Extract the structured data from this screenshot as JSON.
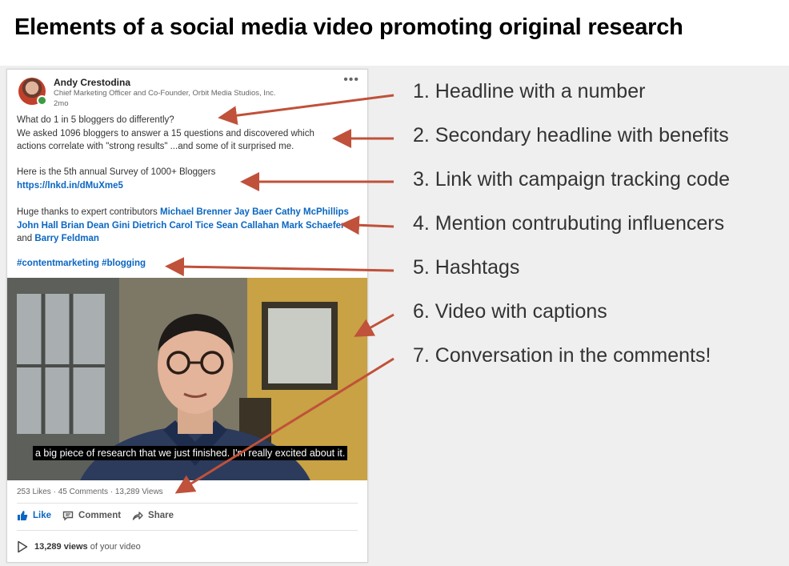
{
  "title": "Elements of a social media video promoting original research",
  "post": {
    "author_name": "Andy Crestodina",
    "author_title": "Chief Marketing Officer and Co-Founder, Orbit Media Studios, Inc.",
    "time": "2mo",
    "more": "•••",
    "line1": "What do 1 in 5 bloggers do differently?",
    "line2a": "We asked 1096 bloggers to answer a 15 questions and discovered which",
    "line2b": "actions correlate with \"strong results\" ...and some of it surprised me.",
    "line3": "Here is the 5th annual Survey of 1000+ Bloggers",
    "link": "https://lnkd.in/dMuXme5",
    "thanks_prefix": "Huge thanks to expert contributors ",
    "contributors": [
      "Michael Brenner",
      "Jay Baer",
      "Cathy McPhillips",
      "John Hall",
      "Brian Dean",
      "Gini Dietrich",
      "Carol Tice",
      "Sean Callahan",
      "Mark Schaefer"
    ],
    "and": " and ",
    "last_contributor": "Barry Feldman",
    "hashtags": "#contentmarketing #blogging",
    "caption": "a big piece of research that we just finished. I'm really excited about it.",
    "stats": "253 Likes · 45 Comments · 13,289 Views",
    "actions": {
      "like": "Like",
      "comment": "Comment",
      "share": "Share"
    },
    "views_count": "13,289 views",
    "views_suffix": " of your video"
  },
  "list": [
    "1. Headline with a number",
    "2. Secondary headline with benefits",
    "3. Link with campaign tracking code",
    "4. Mention contrubuting influencers",
    "5. Hashtags",
    "6. Video with captions",
    "7. Conversation in the comments!"
  ],
  "colors": {
    "arrow": "#c0513a",
    "link": "#0a66c2",
    "panel": "#efefef"
  }
}
